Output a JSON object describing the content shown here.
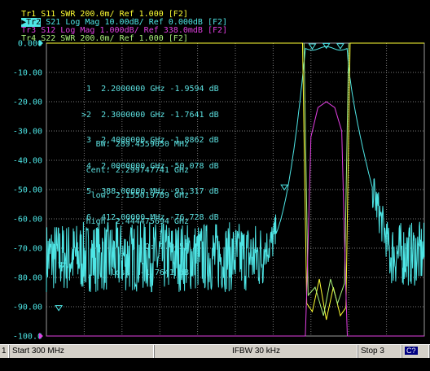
{
  "traces": [
    {
      "id": "Tr1",
      "param": "S11",
      "format": "SWR",
      "scale": "200.0m/",
      "ref": "Ref 1.000",
      "tag": "[F2]",
      "color": "#ffff33",
      "active": false
    },
    {
      "id": "Tr2",
      "param": "S21",
      "format": "Log Mag",
      "scale": "10.00dB/",
      "ref": "Ref 0.000dB",
      "tag": "[F2]",
      "color": "#4ee6e6",
      "active": true
    },
    {
      "id": "Tr3",
      "param": "S12",
      "format": "Log Mag",
      "scale": "1.000dB/",
      "ref": "Ref 338.0mdB",
      "tag": "[F2]",
      "color": "#e23fe2",
      "active": false
    },
    {
      "id": "Tr4",
      "param": "S22",
      "format": "SWR",
      "scale": "200.0m/",
      "ref": "Ref 1.000",
      "tag": "[F2]",
      "color": "#a8f07a",
      "active": false
    }
  ],
  "y_axis": {
    "labels": [
      "0.000",
      "-10.00",
      "-20.00",
      "-30.00",
      "-40.00",
      "-50.00",
      "-60.00",
      "-70.00",
      "-80.00",
      "-90.00",
      "-100.0"
    ]
  },
  "markers": [
    {
      "num": "1",
      "active": false,
      "freq": "2.2000000 GHz",
      "value": "-1.9594 dB"
    },
    {
      "num": "2",
      "active": true,
      "freq": "2.3000000 GHz",
      "value": "-1.7641 dB"
    },
    {
      "num": "3",
      "active": false,
      "freq": "2.4000000 GHz",
      "value": "-1.8862 dB"
    },
    {
      "num": "4",
      "active": false,
      "freq": "2.0000000 GHz",
      "value": "-50.078 dB"
    },
    {
      "num": "5",
      "active": false,
      "freq": "388.00000 MHz",
      "value": "-91.317 dB"
    },
    {
      "num": "6",
      "active": false,
      "freq": "412.00000 MHz",
      "value": "-76.728 dB"
    }
  ],
  "bandwidth": {
    "bw_label": "BW:",
    "bw": "289.4559050 MHz",
    "cent_label": "cent:",
    "cent": "2.299747741 GHz",
    "low_label": "low:",
    "low": "2.155019789 GHz",
    "high_label": "high:",
    "high": "2.444475694 GHz",
    "q_label": "Q:",
    "q": "7.9451",
    "loss_label": "loss:",
    "loss": "-1.7641 dB"
  },
  "status": {
    "channel": "1",
    "start": "Start 300 MHz",
    "ifbw": "IFBW 30 kHz",
    "stop": "Stop 3 GHz",
    "badge": "C?"
  },
  "icons": [
    "active-trace-arrow-icon",
    "marker-triangle-icon",
    "reference-level-arrow-icon"
  ]
}
